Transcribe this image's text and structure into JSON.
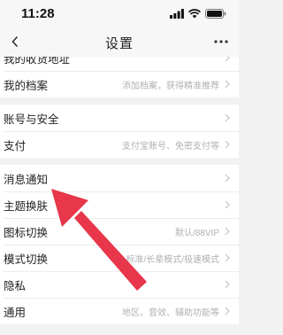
{
  "status_bar": {
    "time": "11:28",
    "icons": [
      "signal-icon",
      "wifi-icon",
      "battery-icon"
    ]
  },
  "nav": {
    "title": "设置",
    "back_icon": "chevron-left-icon",
    "more_icon": "more-dots-icon"
  },
  "groups": [
    {
      "items": [
        {
          "label": "我的收货地址",
          "value": ""
        },
        {
          "label": "我的档案",
          "value": "添加档案，获得精准推荐"
        }
      ]
    },
    {
      "items": [
        {
          "label": "账号与安全",
          "value": ""
        },
        {
          "label": "支付",
          "value": "支付宝账号、免密支付等"
        }
      ]
    },
    {
      "items": [
        {
          "label": "消息通知",
          "value": ""
        },
        {
          "label": "主题换肤",
          "value": ""
        },
        {
          "label": "图标切换",
          "value": "默认/88VIP"
        },
        {
          "label": "模式切换",
          "value": "标准/长辈模式/极速模式"
        },
        {
          "label": "隐私",
          "value": ""
        },
        {
          "label": "通用",
          "value": "地区、音效、辅助功能等"
        }
      ]
    }
  ],
  "annotation": {
    "type": "arrow",
    "color": "#e8364a",
    "points_to": "主题换肤"
  }
}
